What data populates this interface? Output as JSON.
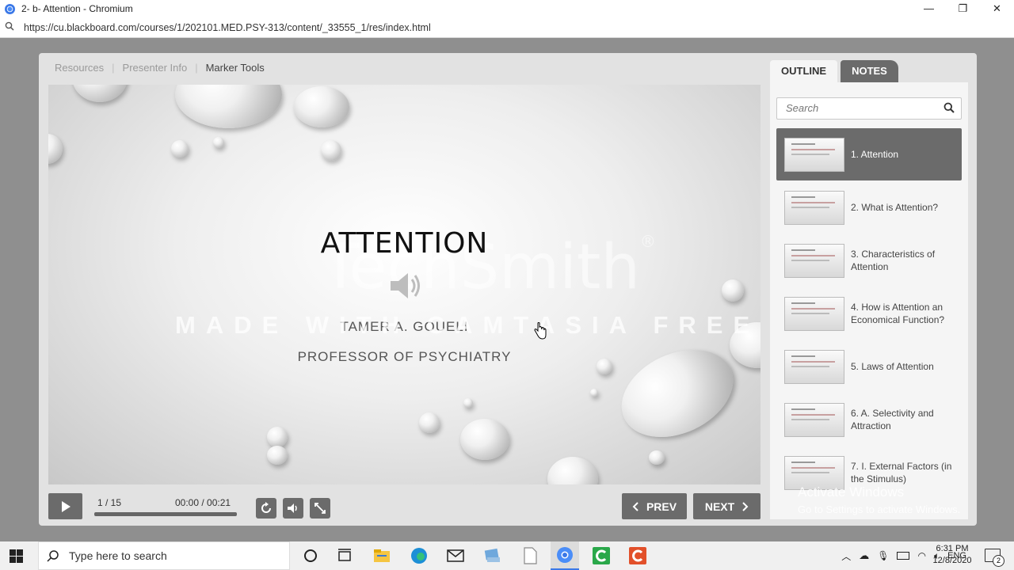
{
  "window": {
    "title": "2- b- Attention - Chromium",
    "minimize": "—",
    "maximize": "❐",
    "close": "✕"
  },
  "address_bar": {
    "url": "https://cu.blackboard.com/courses/1/202101.MED.PSY-313/content/_33555_1/res/index.html"
  },
  "top_nav": {
    "resources": "Resources",
    "presenter_info": "Presenter Info",
    "marker_tools": "Marker Tools",
    "separator": "|"
  },
  "slide": {
    "title": "ATTENTION",
    "author": "TAMER A. GOUELI",
    "role": "PROFESSOR OF PSYCHIATRY",
    "watermark_logo": "TechSmith",
    "watermark_reg": "®",
    "watermark_trial": "MADE WITH CAMTASIA FREE TRIAL"
  },
  "controls": {
    "page_indicator": "1 / 15",
    "time": "00:00 / 00:21",
    "progress_fraction": 0.0,
    "prev_label": "PREV",
    "next_label": "NEXT",
    "prev_icon": "chevron-left-icon",
    "next_icon": "chevron-right-icon"
  },
  "sidebar": {
    "tab_outline": "OUTLINE",
    "tab_notes": "NOTES",
    "search_placeholder": "Search",
    "items": [
      {
        "label": "1. Attention",
        "active": true
      },
      {
        "label": "2. What is Attention?",
        "active": false
      },
      {
        "label": "3. Characteristics of Attention",
        "active": false
      },
      {
        "label": "4. How is Attention an Economical Function?",
        "active": false
      },
      {
        "label": "5. Laws of Attention",
        "active": false
      },
      {
        "label": "6. A. Selectivity and Attraction",
        "active": false
      },
      {
        "label": "7. I. External Factors (in the Stimulus)",
        "active": false
      }
    ]
  },
  "activate_windows": {
    "line1": "Activate Windows",
    "line2": "Go to Settings to activate Windows."
  },
  "taskbar": {
    "search_placeholder": "Type here to search",
    "language": "ENG",
    "time": "6:31 PM",
    "date": "12/8/2020",
    "notification_count": "2"
  },
  "colors": {
    "accent_dark": "#6b6b6b",
    "player_bg": "#e2e2e2",
    "page_bg": "#8f8f8f"
  }
}
